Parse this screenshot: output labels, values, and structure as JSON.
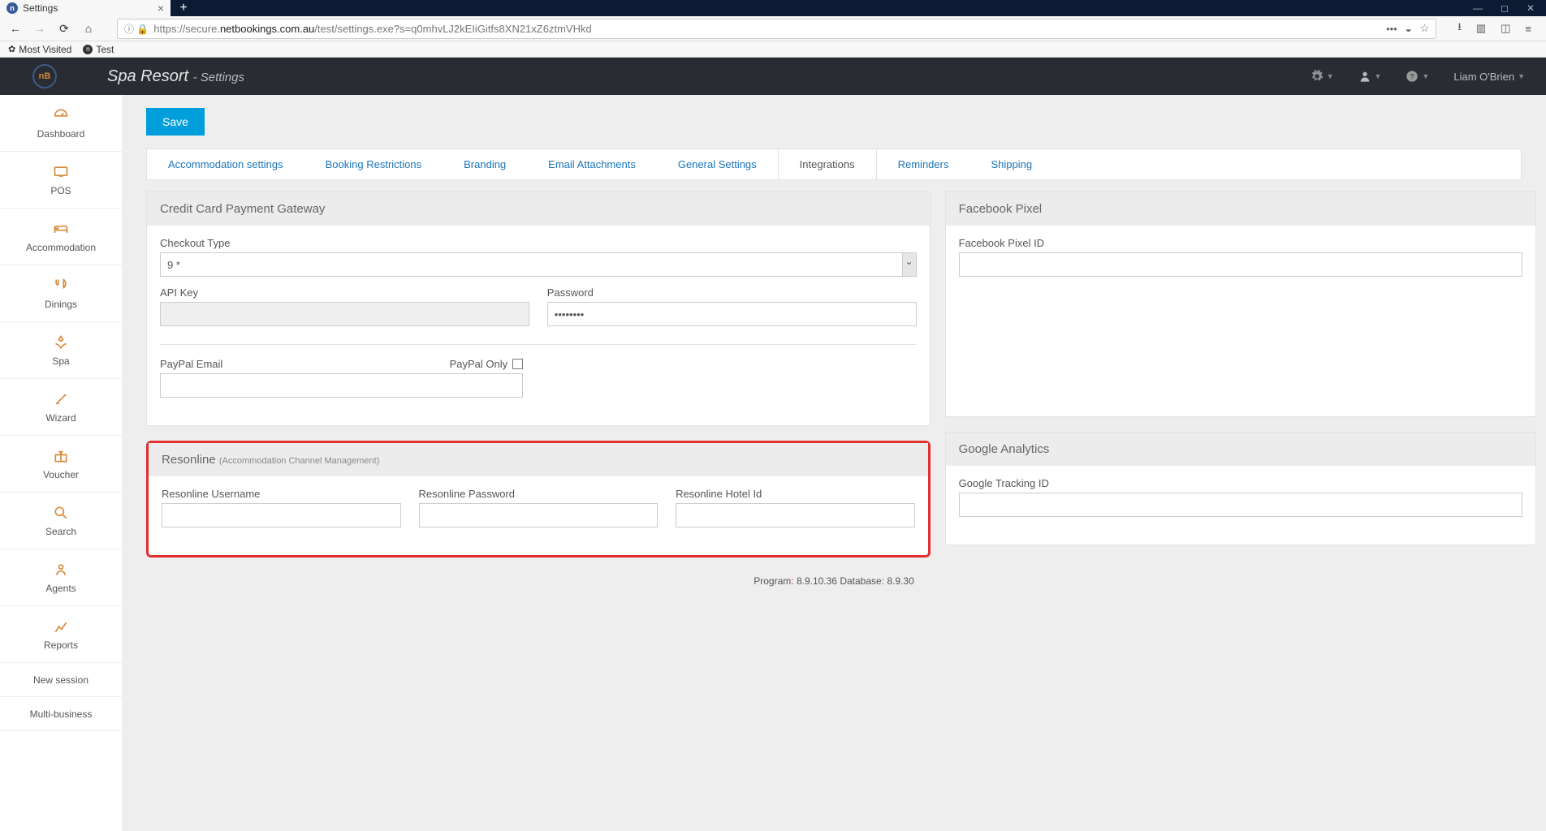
{
  "browser": {
    "tab_title": "Settings",
    "url_prefix": "https://secure.",
    "url_domain": "netbookings.com.au",
    "url_path": "/test/settings.exe?s=q0mhvLJ2kEIiGitfs8XN21xZ6ztmVHkd",
    "bm1": "Most Visited",
    "bm2": "Test"
  },
  "header": {
    "title": "Spa Resort",
    "subtitle": "Settings",
    "user": "Liam O'Brien"
  },
  "sidebar": {
    "items": [
      {
        "label": "Dashboard"
      },
      {
        "label": "POS"
      },
      {
        "label": "Accommodation"
      },
      {
        "label": "Dinings"
      },
      {
        "label": "Spa"
      },
      {
        "label": "Wizard"
      },
      {
        "label": "Voucher"
      },
      {
        "label": "Search"
      },
      {
        "label": "Agents"
      },
      {
        "label": "Reports"
      }
    ],
    "small_items": [
      {
        "label": "New session"
      },
      {
        "label": "Multi-business"
      }
    ]
  },
  "actions": {
    "save": "Save"
  },
  "tabs": [
    "Accommodation settings",
    "Booking Restrictions",
    "Branding",
    "Email Attachments",
    "General Settings",
    "Integrations",
    "Reminders",
    "Shipping"
  ],
  "active_tab": "Integrations",
  "gateway": {
    "title": "Credit Card Payment Gateway",
    "checkout_label": "Checkout Type",
    "checkout_value": "9 *",
    "api_key_label": "API Key",
    "api_key_value": "",
    "password_label": "Password",
    "password_value": "••••••••",
    "paypal_email_label": "PayPal Email",
    "paypal_only_label": "PayPal Only",
    "paypal_email_value": ""
  },
  "resonline": {
    "title": "Resonline",
    "subtitle": "(Accommodation Channel Management)",
    "username_label": "Resonline Username",
    "password_label": "Resonline Password",
    "hotelid_label": "Resonline Hotel Id"
  },
  "fbpixel": {
    "title": "Facebook Pixel",
    "id_label": "Facebook Pixel ID"
  },
  "ga": {
    "title": "Google Analytics",
    "id_label": "Google Tracking ID"
  },
  "footer": {
    "program_label": "Program",
    "program_version": "8.9.10.36",
    "db_label": "Database:",
    "db_version": "8.9.30"
  }
}
